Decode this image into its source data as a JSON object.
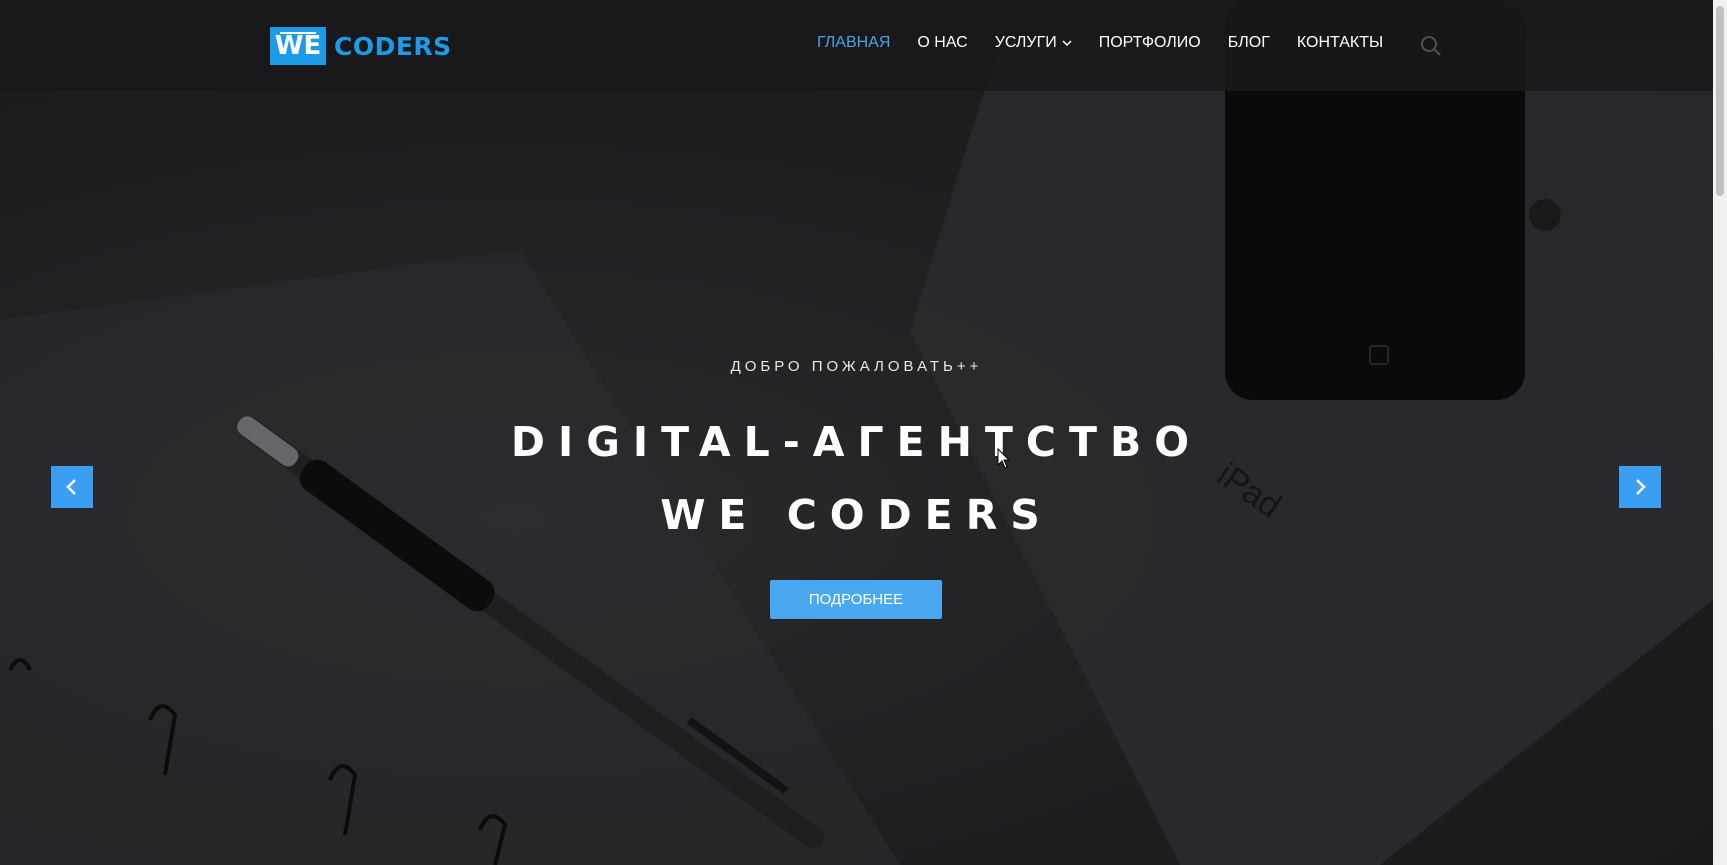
{
  "brand": {
    "logo_box": "WE",
    "logo_text": "CODERS"
  },
  "nav": {
    "items": [
      {
        "label": "ГЛАВНАЯ",
        "active": true
      },
      {
        "label": "О НАС"
      },
      {
        "label": "УСЛУГИ",
        "dropdown": true
      },
      {
        "label": "ПОРТФОЛИО"
      },
      {
        "label": "БЛОГ"
      },
      {
        "label": "КОНТАКТЫ"
      }
    ],
    "search_icon": "search-icon"
  },
  "hero": {
    "subtitle": "ДОБРО ПОЖАЛОВАТЬ++",
    "headline_line1": "DIGITAL-АГЕНТСТВО",
    "headline_line2": "WE CODERS",
    "button_label": "ПОДРОБНЕЕ",
    "background_text": "iPad"
  },
  "colors": {
    "accent": "#1e9be8",
    "button": "#4aa8f0",
    "active_nav": "#4aa3df"
  }
}
